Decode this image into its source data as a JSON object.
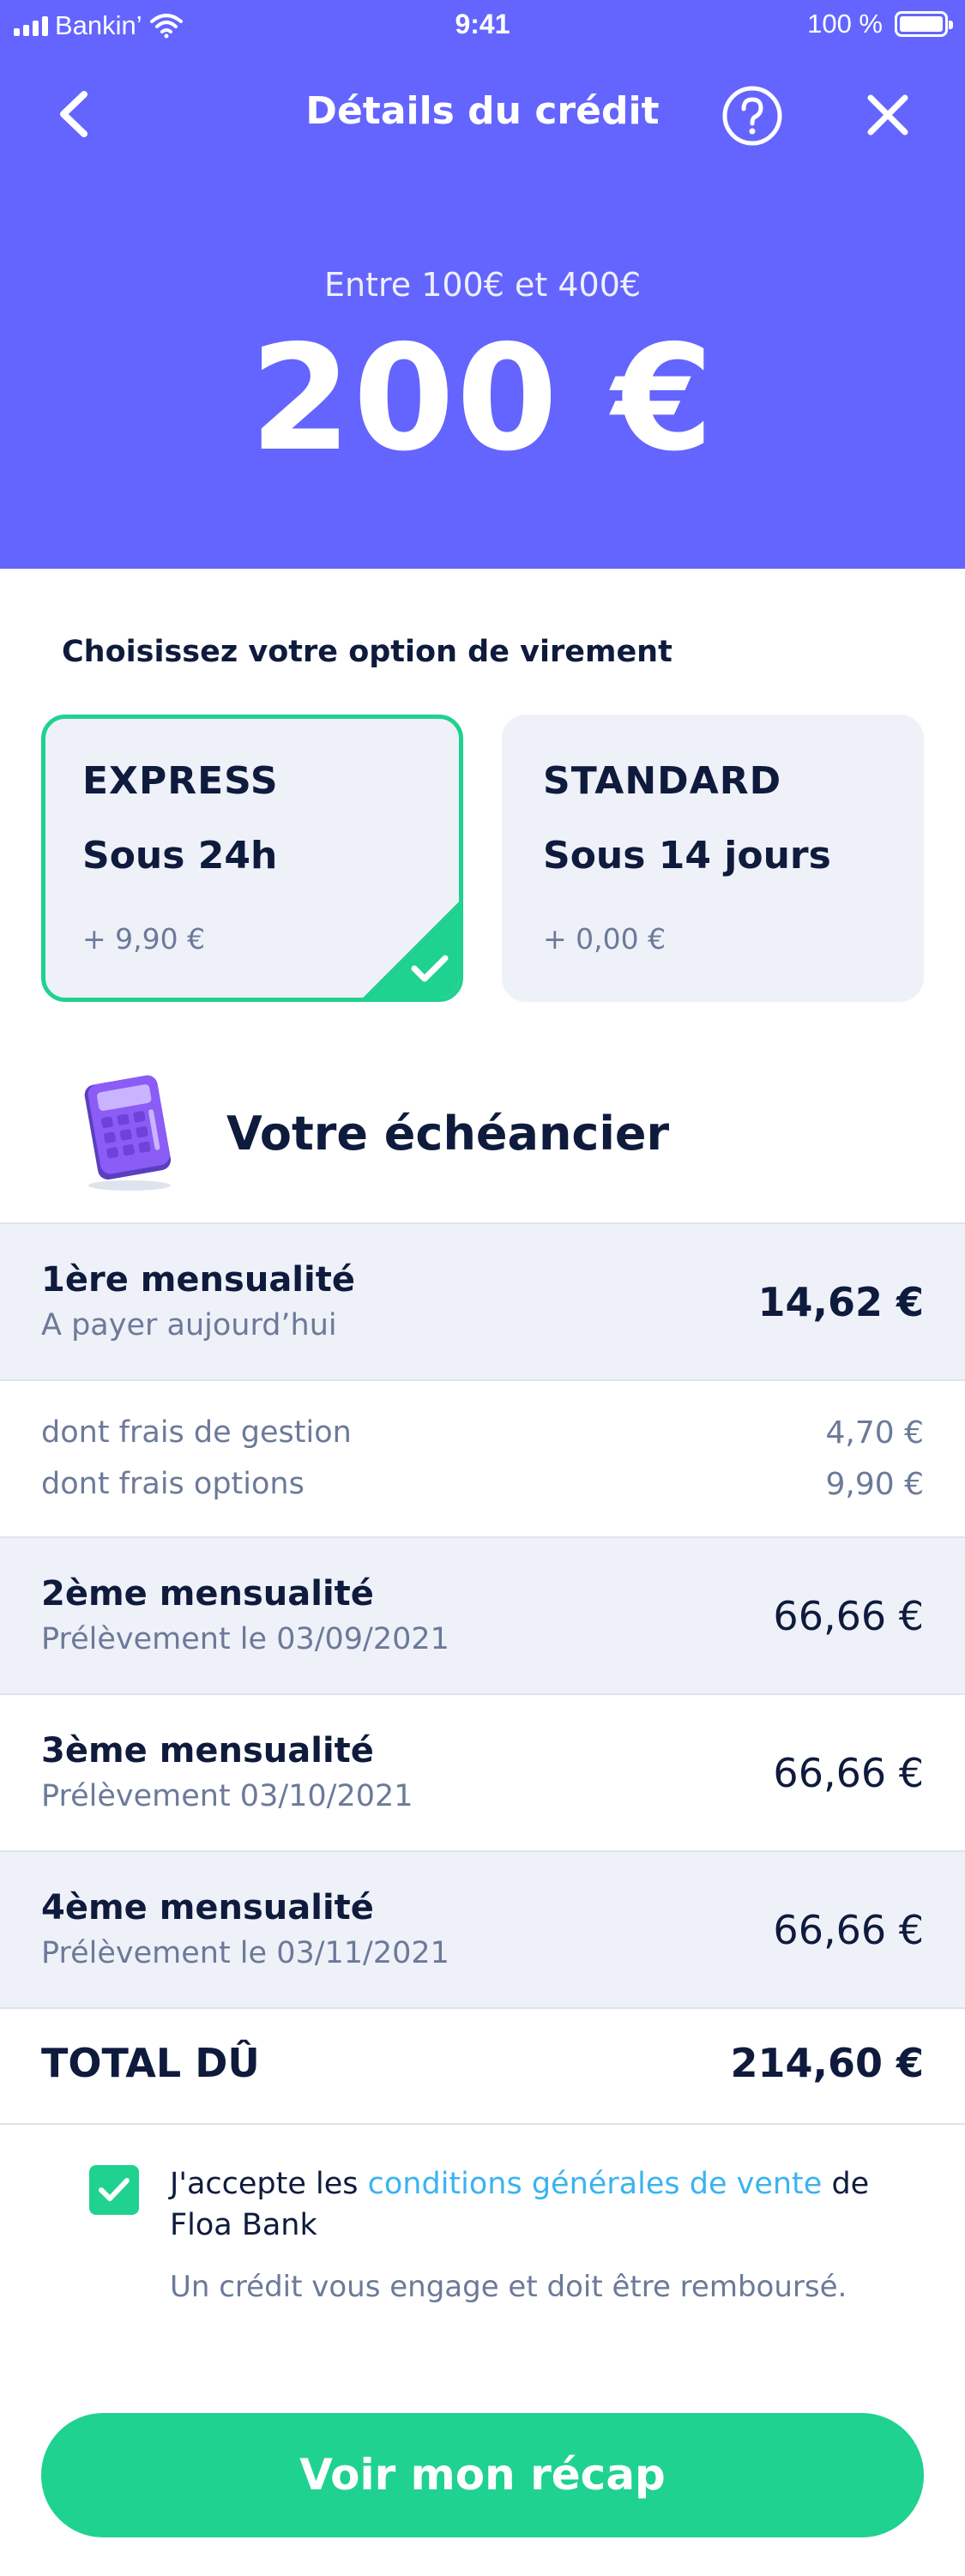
{
  "status_bar": {
    "carrier": "Bankin’",
    "time": "9:41",
    "battery": "100 %"
  },
  "nav": {
    "title": "Détails du crédit",
    "back_icon": "chevron-left-icon",
    "help_icon": "help-circle-icon",
    "close_icon": "close-icon"
  },
  "credit": {
    "range": "Entre 100€ et 400€",
    "amount": "200 €"
  },
  "transfer": {
    "label": "Choisissez votre option de virement",
    "options": [
      {
        "name": "EXPRESS",
        "delay": "Sous 24h",
        "price": "+ 9,90 €",
        "selected": true
      },
      {
        "name": "STANDARD",
        "delay": "Sous 14 jours",
        "price": "+ 0,00 €",
        "selected": false
      }
    ]
  },
  "schedule": {
    "title": "Votre échéancier",
    "first": {
      "title": "1ère mensualité",
      "subtitle": "A payer aujourd’hui",
      "amount": "14,62 €"
    },
    "fees": [
      {
        "label": "dont frais de gestion",
        "value": "4,70 €"
      },
      {
        "label": "dont frais options",
        "value": "9,90 €"
      }
    ],
    "installments": [
      {
        "title": "2ème mensualité",
        "subtitle": "Prélèvement le 03/09/2021",
        "amount": "66,66 €"
      },
      {
        "title": "3ème mensualité",
        "subtitle": "Prélèvement 03/10/2021",
        "amount": "66,66 €"
      },
      {
        "title": "4ème mensualité",
        "subtitle": "Prélèvement le 03/11/2021",
        "amount": "66,66 €"
      }
    ],
    "total": {
      "label": "TOTAL DÛ",
      "value": "214,60 €"
    }
  },
  "terms": {
    "prefix": "J'accepte les ",
    "link": "conditions générales de vente",
    "suffix": " de Floa Bank",
    "note": "Un crédit vous engage et doit être remboursé.",
    "checked": true
  },
  "cta": {
    "label": "Voir mon récap"
  },
  "colors": {
    "header": "#6465fe",
    "accent_green": "#1fd28f",
    "link": "#3ab3f0",
    "row_blue": "#eff1f9",
    "text_dark": "#0f1b3d",
    "text_muted": "#6c7a99"
  }
}
